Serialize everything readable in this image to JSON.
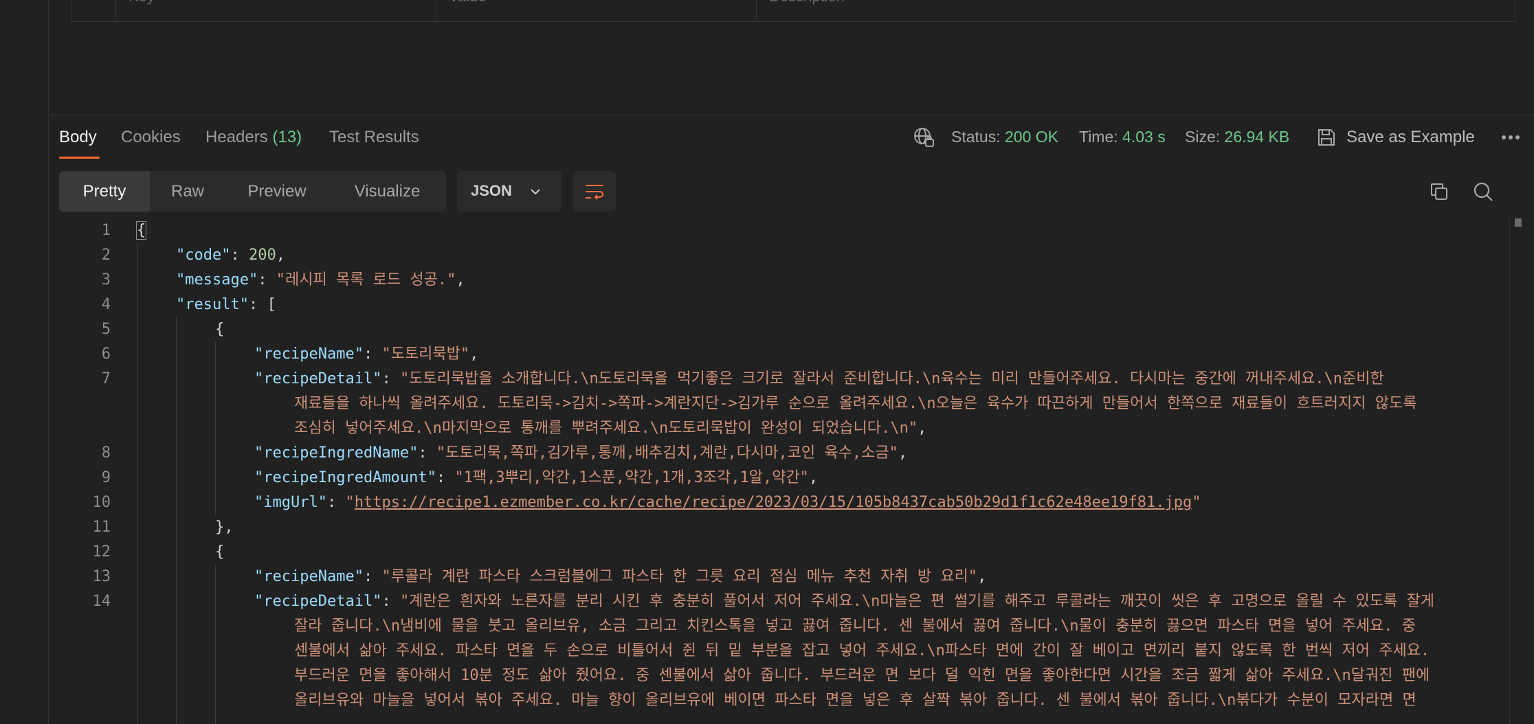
{
  "params_table": {
    "col_key": "Key",
    "col_value": "Value",
    "col_description": "Description"
  },
  "tabs": {
    "body": "Body",
    "cookies": "Cookies",
    "headers": "Headers",
    "headers_count": "(13)",
    "test_results": "Test Results"
  },
  "status": {
    "status_label": "Status:",
    "status_value": "200 OK",
    "time_label": "Time:",
    "time_value": "4.03 s",
    "size_label": "Size:",
    "size_value": "26.94 KB",
    "save_label": "Save as Example"
  },
  "view_modes": [
    "Pretty",
    "Raw",
    "Preview",
    "Visualize"
  ],
  "language": "JSON",
  "icons": [
    "globe-icon",
    "save-icon",
    "more-icon",
    "chevron-down-icon",
    "wrap-lines-icon",
    "copy-icon",
    "search-icon"
  ],
  "colors": {
    "accent": "#ff6c37",
    "success": "#6fc98a"
  },
  "line_numbers": [
    "1",
    "2",
    "3",
    "4",
    "5",
    "6",
    "7",
    "8",
    "9",
    "10",
    "11",
    "12",
    "13",
    "14"
  ],
  "code": {
    "l1": "{",
    "l2k": "\"code\"",
    "l2v": "200",
    "l3k": "\"message\"",
    "l3v": "\"레시피 목록 로드 성공.\"",
    "l4k": "\"result\"",
    "l5": "{",
    "l6k": "\"recipeName\"",
    "l6v": "\"도토리묵밥\"",
    "l7k": "\"recipeDetail\"",
    "l7v1": "\"도토리묵밥을 소개합니다.\\n도토리묵을 먹기좋은 크기로 잘라서 준비합니다.\\n육수는 미리 만들어주세요. 다시마는 중간에 꺼내주세요.\\n준비한",
    "l7v2": "재료들을 하나씩 올려주세요. 도토리묵->김치->쪽파->계란지단->김가루 순으로 올려주세요.\\n오늘은 육수가 따끈하게 만들어서 한쪽으로 재료들이 흐트러지지 않도록",
    "l7v3": "조심히 넣어주세요.\\n마지막으로 통깨를 뿌려주세요.\\n도토리묵밥이 완성이 되었습니다.\\n\"",
    "l8k": "\"recipeIngredName\"",
    "l8v": "\"도토리묵,쪽파,김가루,통깨,배추김치,계란,다시마,코인 육수,소금\"",
    "l9k": "\"recipeIngredAmount\"",
    "l9v": "\"1팩,3뿌리,약간,1스푼,약간,1개,3조각,1알,약간\"",
    "l10k": "\"imgUrl\"",
    "l10url": "https://recipe1.ezmember.co.kr/cache/recipe/2023/03/15/105b8437cab50b29d1f1c62e48ee19f81.jpg",
    "l11": "},",
    "l12": "{",
    "l13k": "\"recipeName\"",
    "l13v": "\"루콜라 계란 파스타 스크럼블에그 파스타 한 그릇 요리 점심 메뉴 추천 자취 방 요리\"",
    "l14k": "\"recipeDetail\"",
    "l14v1": "\"계란은 흰자와 노른자를 분리 시킨 후 충분히 풀어서 저어 주세요.\\n마늘은 편 썰기를 해주고 루콜라는 깨끗이 씻은 후 고명으로 올릴 수 있도록 잘게",
    "l14v2": "잘라 줍니다.\\n냄비에 물을 붓고 올리브유, 소금 그리고 치킨스톡을 넣고 끓여 줍니다. 센 불에서 끓여 줍니다.\\n물이 충분히 끓으면 파스타 면을 넣어 주세요. 중",
    "l14v3": "센불에서 삶아 주세요. 파스타 면을 두 손으로 비틀어서 쥔 뒤 밑 부분을 잡고 넣어 주세요.\\n파스타 면에 간이 잘 베이고 면끼리 붙지 않도록 한 번씩 저어 주세요.",
    "l14v4": "부드러운 면을 좋아해서 10분 정도 삶아 줬어요. 중 센불에서 삶아 줍니다. 부드러운 면 보다 덜 익힌 면을 좋아한다면 시간을 조금 짧게 삶아 주세요.\\n달궈진 팬에",
    "l14v5": "올리브유와 마늘을 넣어서 볶아 주세요. 마늘 향이 올리브유에 베이면 파스타 면을 넣은 후 살짝 볶아 줍니다. 센 불에서 볶아 줍니다.\\n볶다가 수분이 모자라면 면"
  }
}
